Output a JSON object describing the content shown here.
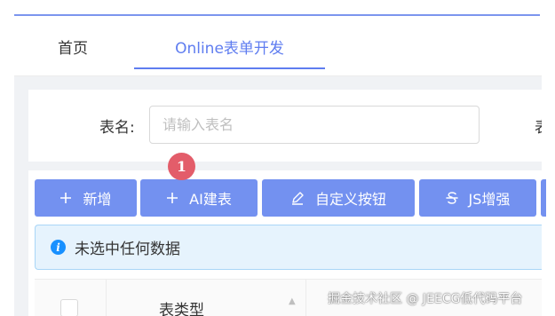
{
  "tabs": [
    {
      "label": "首页"
    },
    {
      "label": "Online表单开发"
    }
  ],
  "search": {
    "label": "表名:",
    "placeholder": "请输入表名",
    "next_label": "表"
  },
  "toolbar": {
    "add": {
      "label": "新增",
      "icon": "plus-icon"
    },
    "ai": {
      "label": "AI建表",
      "icon": "plus-icon"
    },
    "custom": {
      "label": "自定义按钮",
      "icon": "pen-icon"
    },
    "js": {
      "label": "JS增强",
      "icon": "strikethrough-icon"
    }
  },
  "annotation_badge": "1",
  "alert": {
    "text": "未选中任何数据",
    "icon": "info-icon"
  },
  "table": {
    "headers": [
      "表类型"
    ]
  },
  "watermark": "掘金技术社区 @ JEECG低代码平台",
  "colors": {
    "accent": "#5f7df0",
    "button": "#7391f0",
    "badge": "#e35d6a",
    "alert_bg": "#e6f3fd",
    "alert_border": "#a9d6f7"
  }
}
